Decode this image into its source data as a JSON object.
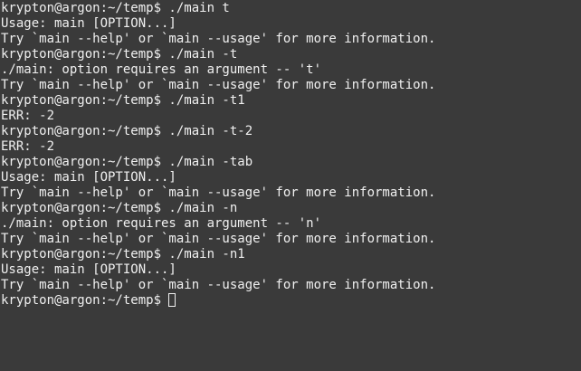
{
  "terminal": {
    "lines": [
      "krypton@argon:~/temp$ ./main t",
      "Usage: main [OPTION...]",
      "Try `main --help' or `main --usage' for more information.",
      "krypton@argon:~/temp$ ./main -t",
      "./main: option requires an argument -- 't'",
      "Try `main --help' or `main --usage' for more information.",
      "krypton@argon:~/temp$ ./main -t1",
      "ERR: -2",
      "krypton@argon:~/temp$ ./main -t-2",
      "ERR: -2",
      "krypton@argon:~/temp$ ./main -tab",
      "Usage: main [OPTION...]",
      "Try `main --help' or `main --usage' for more information.",
      "krypton@argon:~/temp$ ./main -n",
      "./main: option requires an argument -- 'n'",
      "Try `main --help' or `main --usage' for more information.",
      "krypton@argon:~/temp$ ./main -n1",
      "Usage: main [OPTION...]",
      "Try `main --help' or `main --usage' for more information."
    ],
    "prompt": "krypton@argon:~/temp$ ",
    "colors": {
      "background": "#3a3a3a",
      "foreground": "#f0f0f0"
    }
  }
}
